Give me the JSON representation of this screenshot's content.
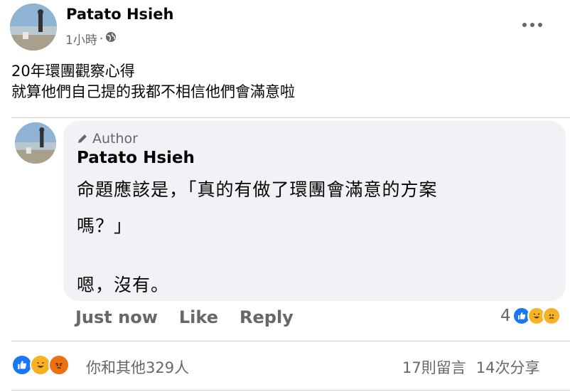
{
  "post": {
    "author": "Patato Hsieh",
    "time": "1小時",
    "separator": "·",
    "lines": [
      "20年環團觀察心得",
      "就算他們自己提的我都不相信他們會滿意啦"
    ]
  },
  "comment": {
    "badge": "Author",
    "author": "Patato Hsieh",
    "lines": [
      "命題應該是，「真的有做了環團會滿意的方案",
      "嗎？」",
      "",
      "嗯，沒有。"
    ],
    "time": "Just now",
    "like_label": "Like",
    "reply_label": "Reply",
    "reaction_count": "4",
    "reaction_icons": [
      "like-icon",
      "haha-icon",
      "sad-icon"
    ]
  },
  "post_footer": {
    "reactions_text": "你和其他329人",
    "reaction_icons": [
      "like-icon",
      "haha-icon",
      "angry-icon"
    ],
    "comments_count": "17則留言",
    "shares_count": "14次分享"
  },
  "colors": {
    "like_blue": "#1877f2",
    "haha_yellow": "#f7b125",
    "angry_red": "#e9710f",
    "bubble_bg": "#f0f2f5",
    "secondary_text": "#65676b"
  }
}
